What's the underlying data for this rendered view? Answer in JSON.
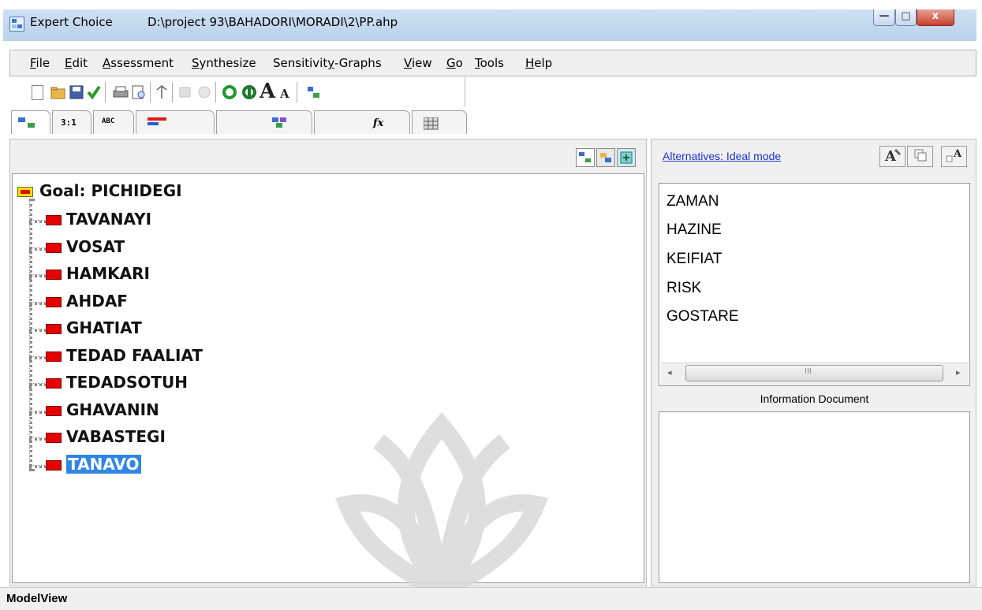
{
  "window": {
    "app_name": "Expert Choice",
    "file_path": "D:\\project 93\\BAHADORI\\MORADI\\2\\PP.ahp",
    "min_glyph": "—",
    "max_glyph": "□",
    "close_glyph": "x"
  },
  "menu": [
    {
      "label": "File",
      "u": "F",
      "rest": "ile"
    },
    {
      "label": "Edit",
      "u": "E",
      "rest": "dit"
    },
    {
      "label": "Assessment",
      "u": "A",
      "rest": "ssessment"
    },
    {
      "label": "Synthesize",
      "u": "S",
      "rest": "ynthesize"
    },
    {
      "label": "Sensitivity-Graphs",
      "pre": "Sensitivit",
      "u": "y",
      "rest": "-Graphs"
    },
    {
      "label": "View",
      "u": "V",
      "rest": "iew"
    },
    {
      "label": "Go",
      "u": "G",
      "rest": "o"
    },
    {
      "label": "Tools",
      "u": "T",
      "rest": "ools"
    },
    {
      "label": "Help",
      "u": "H",
      "rest": "elp"
    }
  ],
  "toolbar": {
    "icons": [
      "new-file-icon",
      "open-folder-icon",
      "save-icon",
      "check-icon",
      "print-icon",
      "print-preview-icon",
      "move-icon",
      "disabled-icon-1",
      "disabled-icon-2",
      "refresh-green-icon",
      "refresh-green-2-icon",
      "font-larger-icon",
      "font-smaller-icon",
      "tree-options-icon"
    ],
    "font_larger": "A",
    "font_smaller": "A"
  },
  "tabs": {
    "tree_view": "tree-view-icon",
    "pairwise": "3:1",
    "verbal": "ABC",
    "bar": "bar-chart-icon",
    "direct": "direct-data-icon",
    "formula": "fx",
    "grid": "grid-icon"
  },
  "view_buttons": [
    "tree-view-mode-icon",
    "cluster-view-icon",
    "add-node-icon"
  ],
  "alternatives": {
    "mode_link": "Alternatives: Ideal mode",
    "buttons": [
      "edit-alternative-icon",
      "copy-alternatives-icon",
      "add-alternative-icon"
    ],
    "items": [
      "ZAMAN",
      "HAZINE",
      "KEIFIAT",
      "RISK",
      "GOSTARE"
    ],
    "scroll_glyph": "III",
    "scroll_left": "◂",
    "scroll_right": "▸"
  },
  "information": {
    "label": "Information Document"
  },
  "tree": {
    "goal": "Goal: PICHIDEGI",
    "nodes": [
      "TAVANAYI",
      "VOSAT",
      "HAMKARI",
      "AHDAF",
      "GHATIAT",
      "TEDAD FAALIAT",
      "TEDADSOTUH",
      "GHAVANIN",
      "VABASTEGI",
      "TANAVO"
    ],
    "selected": "TANAVO"
  },
  "status": {
    "text": "ModelView"
  },
  "colors": {
    "node_red": "#e60000",
    "selection_blue": "#2f86e6",
    "link_blue": "#1a35d6"
  }
}
